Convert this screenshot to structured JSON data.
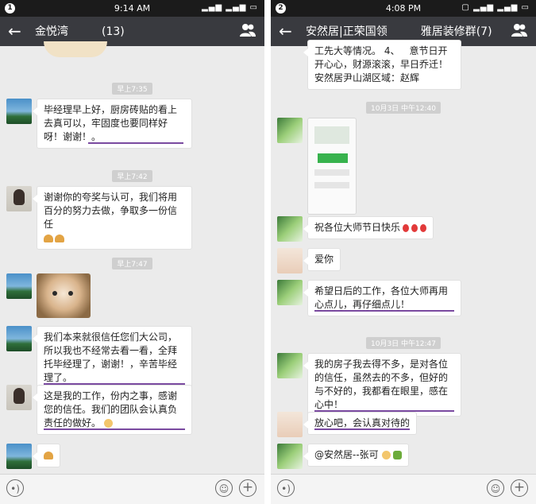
{
  "left": {
    "status": {
      "notif": "1",
      "time": "9:14 AM",
      "signal": "▂▄▆ ▂▄▆ ▭"
    },
    "title": "金悦湾   (13)",
    "timestamps": [
      "早上7:35",
      "早上7:42",
      "早上7:47"
    ],
    "messages": [
      {
        "text": "毕经理早上好，厨房砖贴的看上去真可以，牢固度也要同样好呀！谢谢！。"
      },
      {
        "text": "谢谢你的夸奖与认可，我们将用百分的努力去做，争取多一份信任"
      },
      {
        "text": "我们本来就很信任您们大公司，所以我也不经常去看一看，全拜托毕经理了，谢谢！，辛苦毕经理了。"
      },
      {
        "text": "这是我的工作，份内之事，感谢您的信任。我们的团队会认真负责任的做好。"
      }
    ]
  },
  "right": {
    "status": {
      "notif": "2",
      "time": "4:08 PM",
      "signal": "▢ ▂▄▆ ▂▄▆ ▭"
    },
    "title": "安然居|正荣国领   雅居装修群(7)",
    "timestamps": [
      "10月3日 中午12:40",
      "10月3日 中午12:47"
    ],
    "top_partial": [
      "工先大等情况。 4、 意节日开",
      "开心心，财源滚滚，早日乔迁！",
      "安然居尹山湖区域：赵辉"
    ],
    "messages": [
      {
        "text": "祝各位大师节日快乐"
      },
      {
        "text": "爱你"
      },
      {
        "text": "希望日后的工作，各位大师再用心点儿，再仔细点儿！"
      },
      {
        "text": "我的房子我去得不多，是对各位的信任，虽然去的不多，但好的与不好的，我都看在眼里，感在心中！"
      },
      {
        "text": "放心吧，会认真对待的"
      },
      {
        "text": "@安然居--张可"
      }
    ]
  },
  "colors": {
    "topbar": "#393a3f",
    "underline": "#7a4aa0",
    "chat_bg": "#ebebeb"
  },
  "icons": [
    "back-arrow-icon",
    "group-members-icon",
    "voice-icon",
    "emoji-face-icon",
    "plus-icon"
  ]
}
